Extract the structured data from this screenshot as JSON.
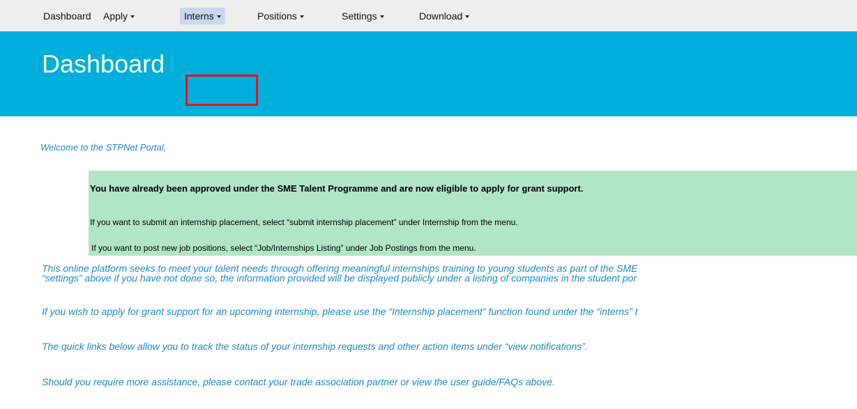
{
  "nav": {
    "items": [
      {
        "label": "Dashboard",
        "dropdown": false,
        "active": false
      },
      {
        "label": "Apply",
        "dropdown": true,
        "active": false
      },
      {
        "label": "Interns",
        "dropdown": true,
        "active": true
      },
      {
        "label": "Positions",
        "dropdown": true,
        "active": false
      },
      {
        "label": "Settings",
        "dropdown": true,
        "active": false
      },
      {
        "label": "Download",
        "dropdown": true,
        "active": false
      }
    ]
  },
  "banner": {
    "title": "Dashboard",
    "color": "#00aedb"
  },
  "welcome": "Welcome to the STPNet Portal,",
  "notice": {
    "heading": "You have already been approved under the SME Talent Programme and are now eligible to apply for grant support.",
    "line1": "If you want to submit an internship placement, select “submit internship placement” under Internship from the menu.",
    "line2": "If you want to post new job positions, select “Job/Internships Listing” under Job Postings from the menu.",
    "color": "#b0e5c6"
  },
  "paragraphs": {
    "p1_line1": "This online platform seeks to meet your talent needs through offering meaningful internships training to young students as part of the SME",
    "p1_line2": "“settings” above if you have not done so, the information provided will be displayed publicly under a listing of companies in the student por",
    "p2": "If you wish to apply for grant support for an upcoming internship, please use the “Internship placement” function found under the “interns” t",
    "p3": "The quick links below allow you to track the status of your internship requests and other action items under “view notifications”.",
    "p4": "Should you require more assistance, please contact your trade association partner or view the user guide/FAQs above."
  },
  "colors": {
    "link_text": "#1a8ccc",
    "highlight_border": "#e8141a",
    "nav_background": "#eeeeee"
  }
}
